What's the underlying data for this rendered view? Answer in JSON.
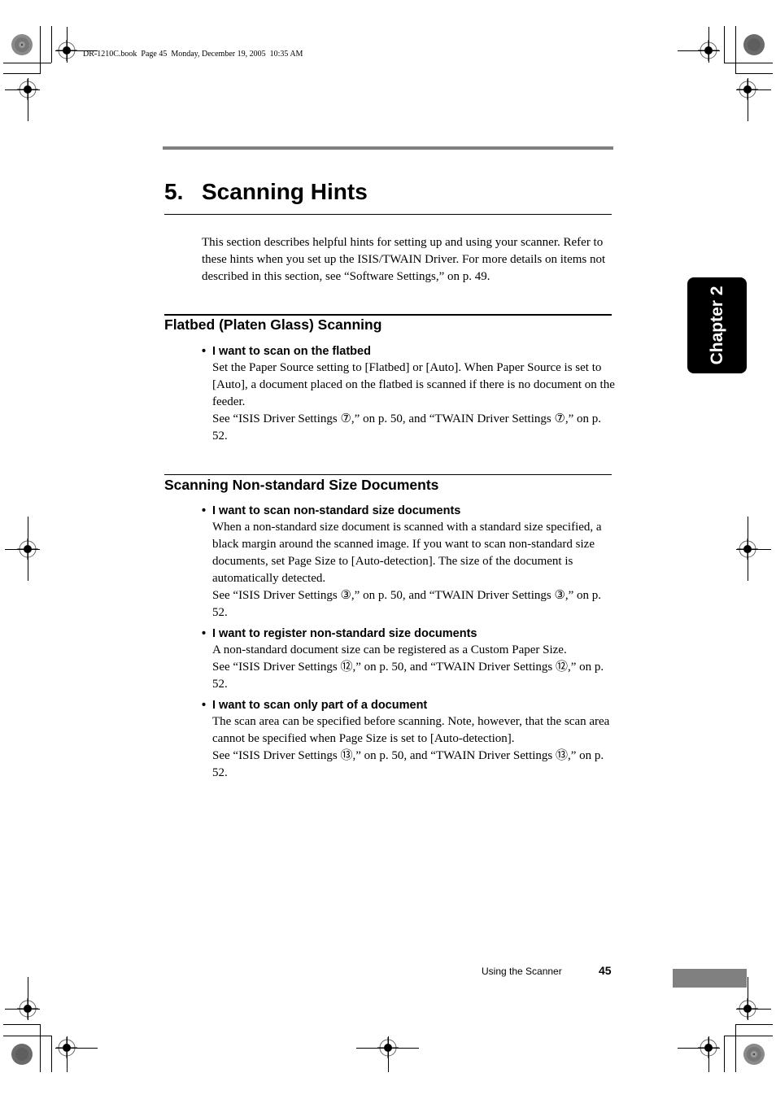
{
  "print_slug": "DR-1210C.book  Page 45  Monday, December 19, 2005  10:35 AM",
  "chapter_tab": "Chapter 2",
  "heading": {
    "number": "5.",
    "title": "Scanning Hints"
  },
  "intro": "This section describes helpful hints for setting up and using your scanner. Refer to these hints when you set up the ISIS/TWAIN Driver. For more details on items not described in this section, see “Software Settings,” on p. 49.",
  "sections": [
    {
      "title": "Flatbed (Platen Glass) Scanning",
      "items": [
        {
          "bullet": "•",
          "heading": "I want to scan on the flatbed",
          "text": "Set the Paper Source setting to [Flatbed] or [Auto]. When Paper Source is set to [Auto], a document placed on the flatbed is scanned if there is no document on the feeder.",
          "reference": "See “ISIS Driver Settings ⑦,” on p. 50, and “TWAIN Driver Settings ⑦,” on p. 52."
        }
      ]
    },
    {
      "title": "Scanning Non-standard Size Documents",
      "items": [
        {
          "bullet": "•",
          "heading": "I want to scan non-standard size documents",
          "text": "When a non-standard size document is scanned with a standard size specified, a black margin around the scanned image. If you want to scan non-standard size documents, set Page Size to [Auto-detection]. The size of the document is automatically detected.",
          "reference": "See “ISIS Driver Settings ③,” on p. 50, and “TWAIN Driver Settings ③,” on p. 52."
        },
        {
          "bullet": "•",
          "heading": "I want to register non-standard size documents",
          "text": "A non-standard document size can be registered as a Custom Paper Size.",
          "reference": "See “ISIS Driver Settings ⑫,” on p. 50, and “TWAIN Driver Settings ⑫,” on p. 52."
        },
        {
          "bullet": "•",
          "heading": "I want to scan only part of a document",
          "text": "The scan area can be specified before scanning. Note, however, that the scan area cannot be specified when Page Size is set to [Auto-detection].",
          "reference": "See “ISIS Driver Settings ⑬,” on p. 50, and “TWAIN Driver Settings ⑬,” on p. 52."
        }
      ]
    }
  ],
  "footer": {
    "section_label": "Using the Scanner",
    "page_number": "45"
  },
  "colors": {
    "rule_gray": "#808080",
    "tab_bg": "#000000",
    "tab_text": "#ffffff"
  }
}
